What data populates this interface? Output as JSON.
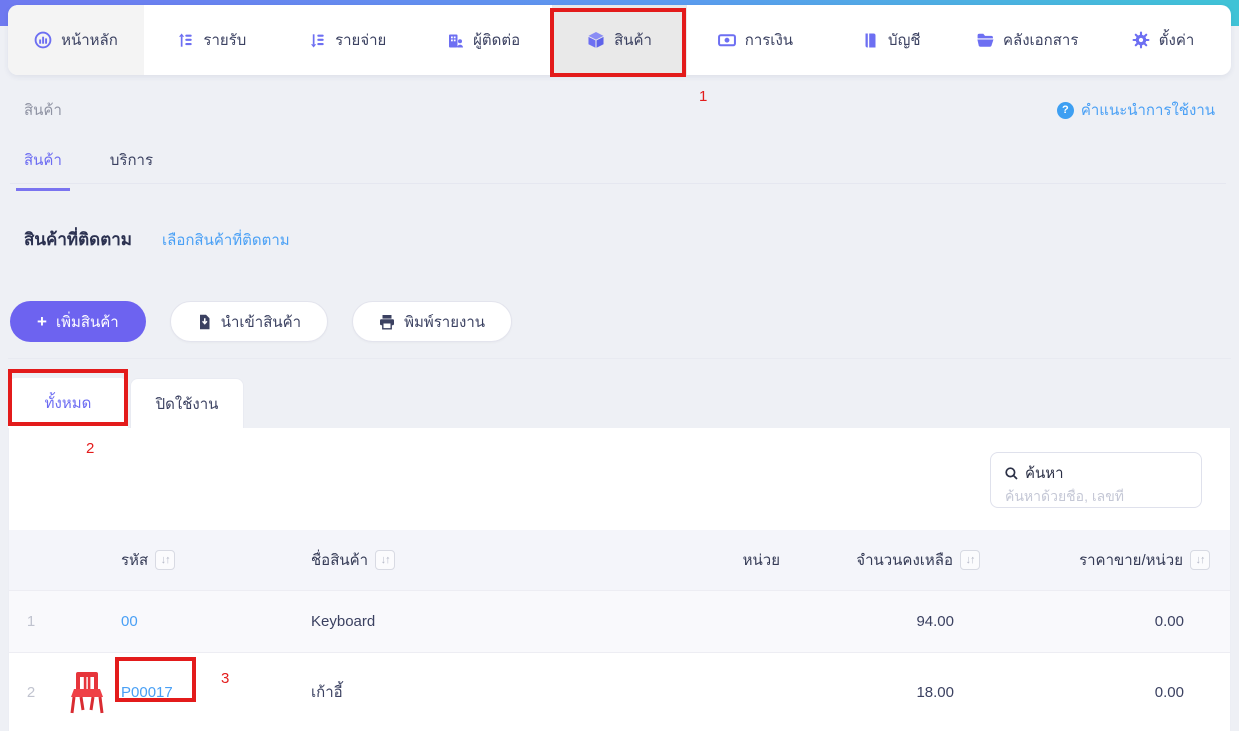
{
  "colors": {
    "accent": "#6c68f0",
    "link": "#4aa0f5",
    "annotation_red": "#e31b1b",
    "topbar_gradient_start": "#6e79f0",
    "topbar_gradient_end": "#3fc3d6"
  },
  "nav": {
    "items": [
      {
        "label": "หน้าหลัก",
        "icon": "dashboard-icon"
      },
      {
        "label": "รายรับ",
        "icon": "income-icon"
      },
      {
        "label": "รายจ่าย",
        "icon": "expense-icon"
      },
      {
        "label": "ผู้ติดต่อ",
        "icon": "contacts-icon"
      },
      {
        "label": "สินค้า",
        "icon": "products-icon"
      },
      {
        "label": "การเงิน",
        "icon": "finance-icon"
      },
      {
        "label": "บัญชี",
        "icon": "accounting-icon"
      },
      {
        "label": "คลังเอกสาร",
        "icon": "documents-icon"
      },
      {
        "label": "ตั้งค่า",
        "icon": "settings-icon"
      }
    ]
  },
  "breadcrumb": "สินค้า",
  "help": {
    "label": "คำแนะนำการใช้งาน",
    "icon_glyph": "?"
  },
  "page_tabs": {
    "products": "สินค้า",
    "services": "บริการ"
  },
  "tracked": {
    "title": "สินค้าที่ติดตาม",
    "link": "เลือกสินค้าที่ติดตาม"
  },
  "toolbar": {
    "add": "เพิ่มสินค้า",
    "add_plus": "+",
    "import": "นำเข้าสินค้า",
    "print": "พิมพ์รายงาน"
  },
  "filter_tabs": {
    "all": "ทั้งหมด",
    "disabled": "ปิดใช้งาน"
  },
  "search": {
    "label": "ค้นหา",
    "placeholder": "ค้นหาด้วยชื่อ, เลขที่"
  },
  "sort_glyph": "↓↑",
  "table": {
    "columns": {
      "code": "รหัส",
      "name": "ชื่อสินค้า",
      "unit": "หน่วย",
      "qty": "จำนวนคงเหลือ",
      "price": "ราคาขาย/หน่วย"
    },
    "rows": [
      {
        "no": "1",
        "code": "00",
        "name": "Keyboard",
        "unit": "",
        "qty": "94.00",
        "price": "0.00"
      },
      {
        "no": "2",
        "code": "P00017",
        "name": "เก้าอี้",
        "unit": "",
        "qty": "18.00",
        "price": "0.00",
        "image": "red-chair-thumbnail"
      }
    ]
  },
  "annotations": {
    "one": "1",
    "two": "2",
    "three": "3"
  }
}
